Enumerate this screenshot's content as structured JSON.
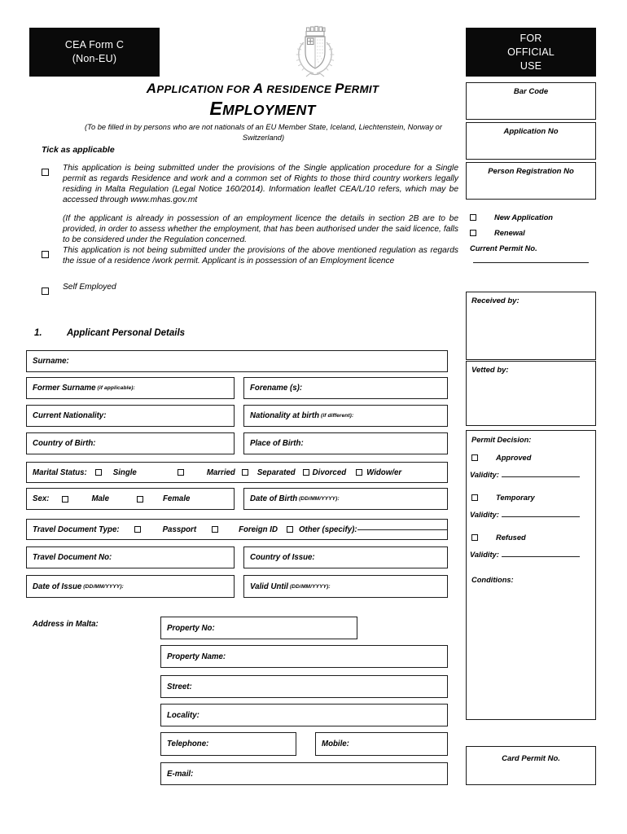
{
  "form_tag": {
    "line1": "CEA Form C",
    "line2": "(Non-EU)"
  },
  "official_use_banner": {
    "line1": "FOR",
    "line2": "OFFICIAL",
    "line3": "USE"
  },
  "emblem": {
    "name": "malta-coat-of-arms"
  },
  "title": {
    "line1_parts": [
      "A",
      "PPLICATION FOR ",
      "A",
      "  R",
      "ESIDENCE ",
      "P",
      "ERMIT"
    ],
    "line1": "APPLICATION FOR A  RESIDENCE PERMIT",
    "line2": "EMPLOYMENT",
    "subtitle": "(To be filled in by persons who are not nationals of an EU Member State, Iceland, Liechtenstein, Norway or Switzerland)"
  },
  "tick_section": {
    "heading": "Tick as applicable",
    "option1": "This application is being submitted under the provisions of the Single application procedure for a Single permit as regards Residence and work and a common set of Rights to those third country workers legally residing in Malta Regulation (Legal Notice  160/2014). Information leaflet CEA/L/10 refers, which may be accessed through www.mhas.gov.mt",
    "option1_note": "(If the applicant is already in possession of an employment licence the details in section 2B are to be provided, in order to assess whether the employment, that has been authorised under the said licence, falls to be considered under the Regulation concerned.",
    "option2": "This application is not being submitted under the provisions of the above mentioned regulation as regards the issue of a residence /work permit. Applicant is in possession of an Employment licence",
    "option3": "Self Employed"
  },
  "official_use": {
    "bar_code_label": "Bar Code",
    "application_no_label": "Application No",
    "person_registration_no_label": "Person Registration No",
    "new_application_label": "New Application",
    "renewal_label": "Renewal",
    "current_permit_no_label": "Current Permit No.",
    "received_by_label": "Received by:",
    "vetted_by_label": "Vetted by:",
    "permit_decision_label": "Permit Decision:",
    "approved_label": "Approved",
    "temporary_label": "Temporary",
    "refused_label": "Refused",
    "validity_label": "Validity:",
    "conditions_label": "Conditions:",
    "card_permit_no_label": "Card Permit No."
  },
  "section1": {
    "number": "1.",
    "heading": "Applicant Personal Details",
    "surname_label": "Surname:",
    "former_surname_label": "Former Surname",
    "former_surname_hint": "(if applicable):",
    "forename_label": "Forename (s):",
    "current_nationality_label": "Current Nationality:",
    "nationality_at_birth_label": "Nationality at birth",
    "nationality_at_birth_hint": "(if different):",
    "country_of_birth_label": "Country of Birth:",
    "place_of_birth_label": "Place of Birth:",
    "marital_status_label": "Marital Status:",
    "marital_options": [
      "Single",
      "Married",
      "Separated",
      "Divorced",
      "Widow/er"
    ],
    "sex_label": "Sex:",
    "sex_options": [
      "Male",
      "Female"
    ],
    "date_of_birth_label": "Date of Birth",
    "date_of_birth_hint": "(DD/MM/YYYY):",
    "travel_doc_type_label": "Travel Document Type:",
    "travel_doc_options": [
      "Passport",
      "Foreign ID"
    ],
    "travel_doc_other_label": "Other (specify):",
    "travel_doc_no_label": "Travel Document No:",
    "country_of_issue_label": "Country of Issue:",
    "date_of_issue_label": "Date of Issue",
    "date_of_issue_hint": "(DD/MM/YYYY):",
    "valid_until_label": "Valid Until",
    "valid_until_hint": "(DD/MM/YYYY):",
    "address_label": "Address in Malta:",
    "property_no_label": "Property No:",
    "property_name_label": "Property Name:",
    "street_label": "Street:",
    "locality_label": "Locality:",
    "telephone_label": "Telephone:",
    "mobile_label": "Mobile:",
    "email_label": "E-mail:"
  }
}
